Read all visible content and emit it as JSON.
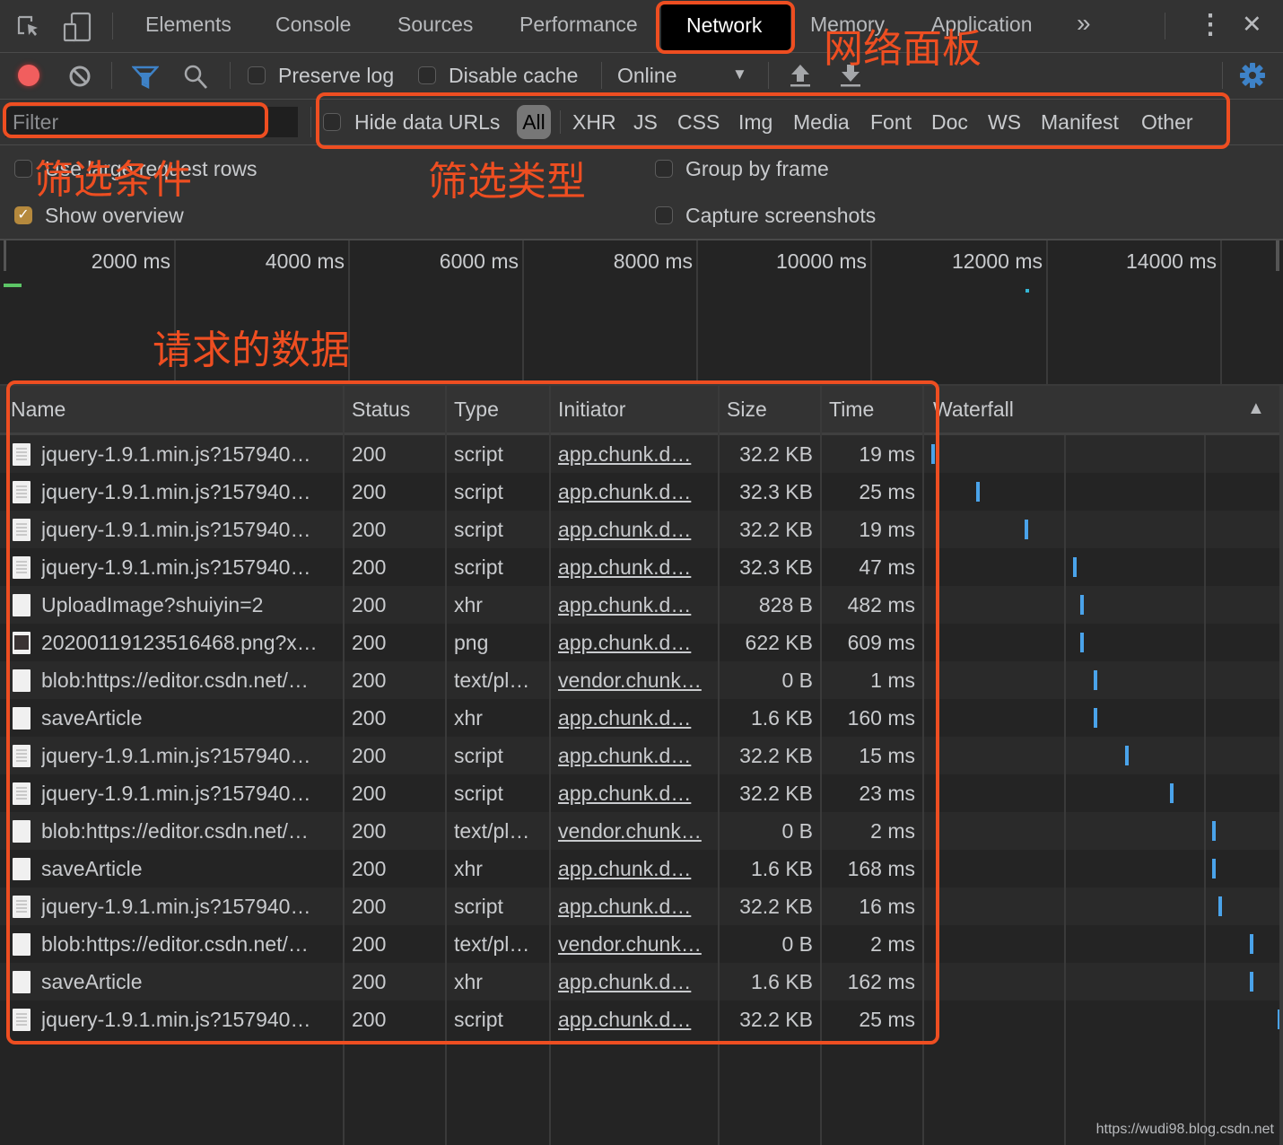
{
  "tabbar": {
    "tabs": [
      "Elements",
      "Console",
      "Sources",
      "Performance",
      "Network",
      "Memory",
      "Application"
    ],
    "active_tab": "Network",
    "more_label": "»",
    "kebab_label": "⋮",
    "close_label": "✕"
  },
  "toolbar": {
    "preserve_log": {
      "label": "Preserve log",
      "checked": false
    },
    "disable_cache": {
      "label": "Disable cache",
      "checked": false
    },
    "throttling": {
      "value": "Online"
    },
    "record_color": "#f15e5e",
    "accent_color": "#3e82c7"
  },
  "filterbar": {
    "filter_placeholder": "Filter",
    "filter_value": "",
    "hide_data_urls": {
      "label": "Hide data URLs",
      "checked": false
    },
    "types": [
      "All",
      "XHR",
      "JS",
      "CSS",
      "Img",
      "Media",
      "Font",
      "Doc",
      "WS",
      "Manifest",
      "Other"
    ],
    "active_type": "All"
  },
  "settings": {
    "large_rows": {
      "label": "Use large request rows",
      "checked": false
    },
    "group_by_frame": {
      "label": "Group by frame",
      "checked": false
    },
    "show_overview": {
      "label": "Show overview",
      "checked": true
    },
    "capture_screenshots": {
      "label": "Capture screenshots",
      "checked": false
    }
  },
  "overview": {
    "ticks": [
      "2000 ms",
      "4000 ms",
      "6000 ms",
      "8000 ms",
      "10000 ms",
      "12000 ms",
      "14000 ms"
    ]
  },
  "table": {
    "columns": [
      "Name",
      "Status",
      "Type",
      "Initiator",
      "Size",
      "Time",
      "Waterfall"
    ],
    "sort_indicator": "▲",
    "rows": [
      {
        "name": "jquery-1.9.1.min.js?157940…",
        "icon": "script",
        "status": "200",
        "type": "script",
        "initiator": "app.chunk.d…",
        "size": "32.2 KB",
        "time": "19 ms",
        "wf": 0.0
      },
      {
        "name": "jquery-1.9.1.min.js?157940…",
        "icon": "script",
        "status": "200",
        "type": "script",
        "initiator": "app.chunk.d…",
        "size": "32.3 KB",
        "time": "25 ms",
        "wf": 0.13
      },
      {
        "name": "jquery-1.9.1.min.js?157940…",
        "icon": "script",
        "status": "200",
        "type": "script",
        "initiator": "app.chunk.d…",
        "size": "32.2 KB",
        "time": "19 ms",
        "wf": 0.27
      },
      {
        "name": "jquery-1.9.1.min.js?157940…",
        "icon": "script",
        "status": "200",
        "type": "script",
        "initiator": "app.chunk.d…",
        "size": "32.3 KB",
        "time": "47 ms",
        "wf": 0.41
      },
      {
        "name": "UploadImage?shuiyin=2",
        "icon": "blank",
        "status": "200",
        "type": "xhr",
        "initiator": "app.chunk.d…",
        "size": "828 B",
        "time": "482 ms",
        "wf": 0.43
      },
      {
        "name": "20200119123516468.png?x…",
        "icon": "image",
        "status": "200",
        "type": "png",
        "initiator": "app.chunk.d…",
        "size": "622 KB",
        "time": "609 ms",
        "wf": 0.43
      },
      {
        "name": "blob:https://editor.csdn.net/…",
        "icon": "blank",
        "status": "200",
        "type": "text/pl…",
        "initiator": "vendor.chunk…",
        "size": "0 B",
        "time": "1 ms",
        "wf": 0.47
      },
      {
        "name": "saveArticle",
        "icon": "blank",
        "status": "200",
        "type": "xhr",
        "initiator": "app.chunk.d…",
        "size": "1.6 KB",
        "time": "160 ms",
        "wf": 0.47
      },
      {
        "name": "jquery-1.9.1.min.js?157940…",
        "icon": "script",
        "status": "200",
        "type": "script",
        "initiator": "app.chunk.d…",
        "size": "32.2 KB",
        "time": "15 ms",
        "wf": 0.56
      },
      {
        "name": "jquery-1.9.1.min.js?157940…",
        "icon": "script",
        "status": "200",
        "type": "script",
        "initiator": "app.chunk.d…",
        "size": "32.2 KB",
        "time": "23 ms",
        "wf": 0.69
      },
      {
        "name": "blob:https://editor.csdn.net/…",
        "icon": "blank",
        "status": "200",
        "type": "text/pl…",
        "initiator": "vendor.chunk…",
        "size": "0 B",
        "time": "2 ms",
        "wf": 0.81
      },
      {
        "name": "saveArticle",
        "icon": "blank",
        "status": "200",
        "type": "xhr",
        "initiator": "app.chunk.d…",
        "size": "1.6 KB",
        "time": "168 ms",
        "wf": 0.81
      },
      {
        "name": "jquery-1.9.1.min.js?157940…",
        "icon": "script",
        "status": "200",
        "type": "script",
        "initiator": "app.chunk.d…",
        "size": "32.2 KB",
        "time": "16 ms",
        "wf": 0.83
      },
      {
        "name": "blob:https://editor.csdn.net/…",
        "icon": "blank",
        "status": "200",
        "type": "text/pl…",
        "initiator": "vendor.chunk…",
        "size": "0 B",
        "time": "2 ms",
        "wf": 0.92
      },
      {
        "name": "saveArticle",
        "icon": "blank",
        "status": "200",
        "type": "xhr",
        "initiator": "app.chunk.d…",
        "size": "1.6 KB",
        "time": "162 ms",
        "wf": 0.92
      },
      {
        "name": "jquery-1.9.1.min.js?157940…",
        "icon": "script",
        "status": "200",
        "type": "script",
        "initiator": "app.chunk.d…",
        "size": "32.2 KB",
        "time": "25 ms",
        "wf": 1.0
      }
    ]
  },
  "annotations": {
    "network_panel": "网络面板",
    "filter_condition": "筛选条件",
    "filter_type": "筛选类型",
    "request_data": "请求的数据",
    "color": "#ee4e21"
  },
  "watermark": "https://wudi98.blog.csdn.net"
}
